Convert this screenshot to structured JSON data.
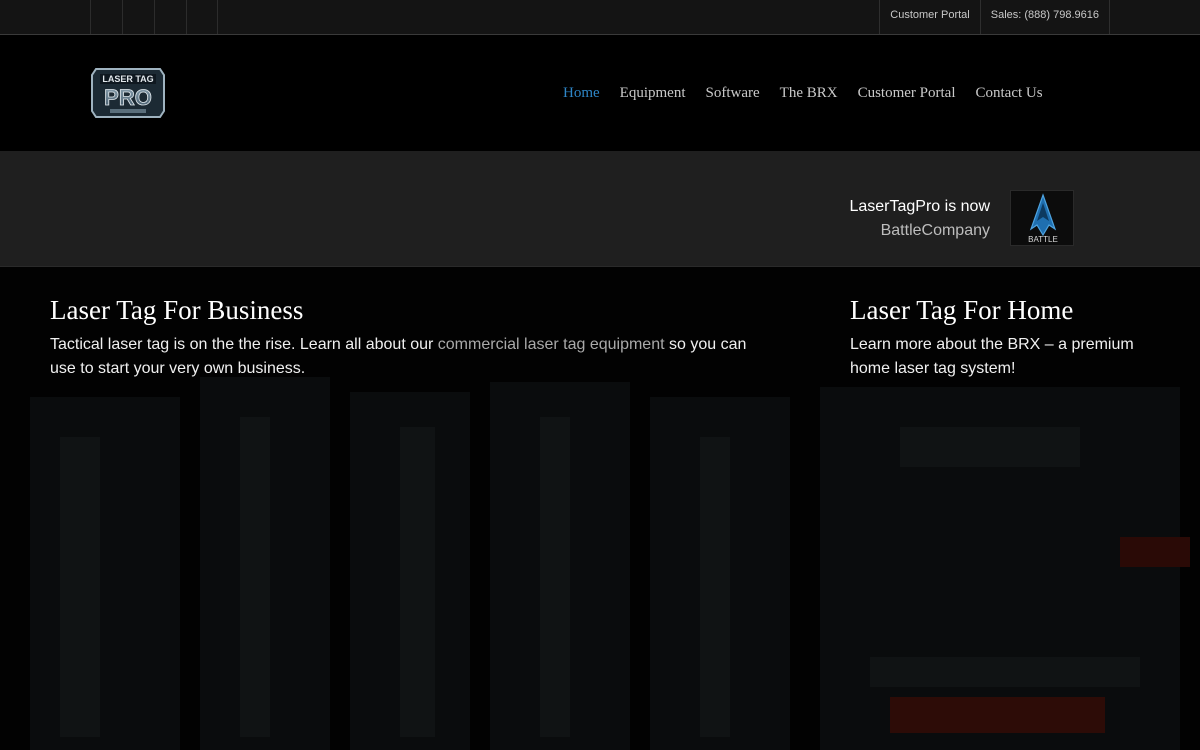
{
  "topbar": {
    "social_icons": [
      "facebook-icon",
      "twitter-icon",
      "youtube-icon",
      "linkedin-icon"
    ],
    "customer_portal": "Customer Portal",
    "sales": "Sales: (888) 798.9616"
  },
  "header": {
    "logo_text_top": "LASER TAG",
    "logo_text_main": "PRO",
    "nav": [
      "Home",
      "Equipment",
      "Software",
      "The BRX",
      "Customer Portal",
      "Contact Us"
    ],
    "active_nav": "Home",
    "colors": {
      "active": "#2e86c7",
      "nav": "#c9c9c9"
    }
  },
  "announcement": {
    "line1": "LaserTagPro is now",
    "line2": "BattleCompany",
    "badge_text": "BATTLE"
  },
  "hero": {
    "business": {
      "title": "Laser Tag For Business",
      "text_before": "Tactical laser tag is on the the rise. Learn all about our ",
      "link": "commercial laser tag equipment",
      "text_after": " so you can use to start your very own business."
    },
    "home": {
      "title": "Laser Tag For Home",
      "text": "Learn more about the BRX – a premium home laser tag system!"
    }
  }
}
